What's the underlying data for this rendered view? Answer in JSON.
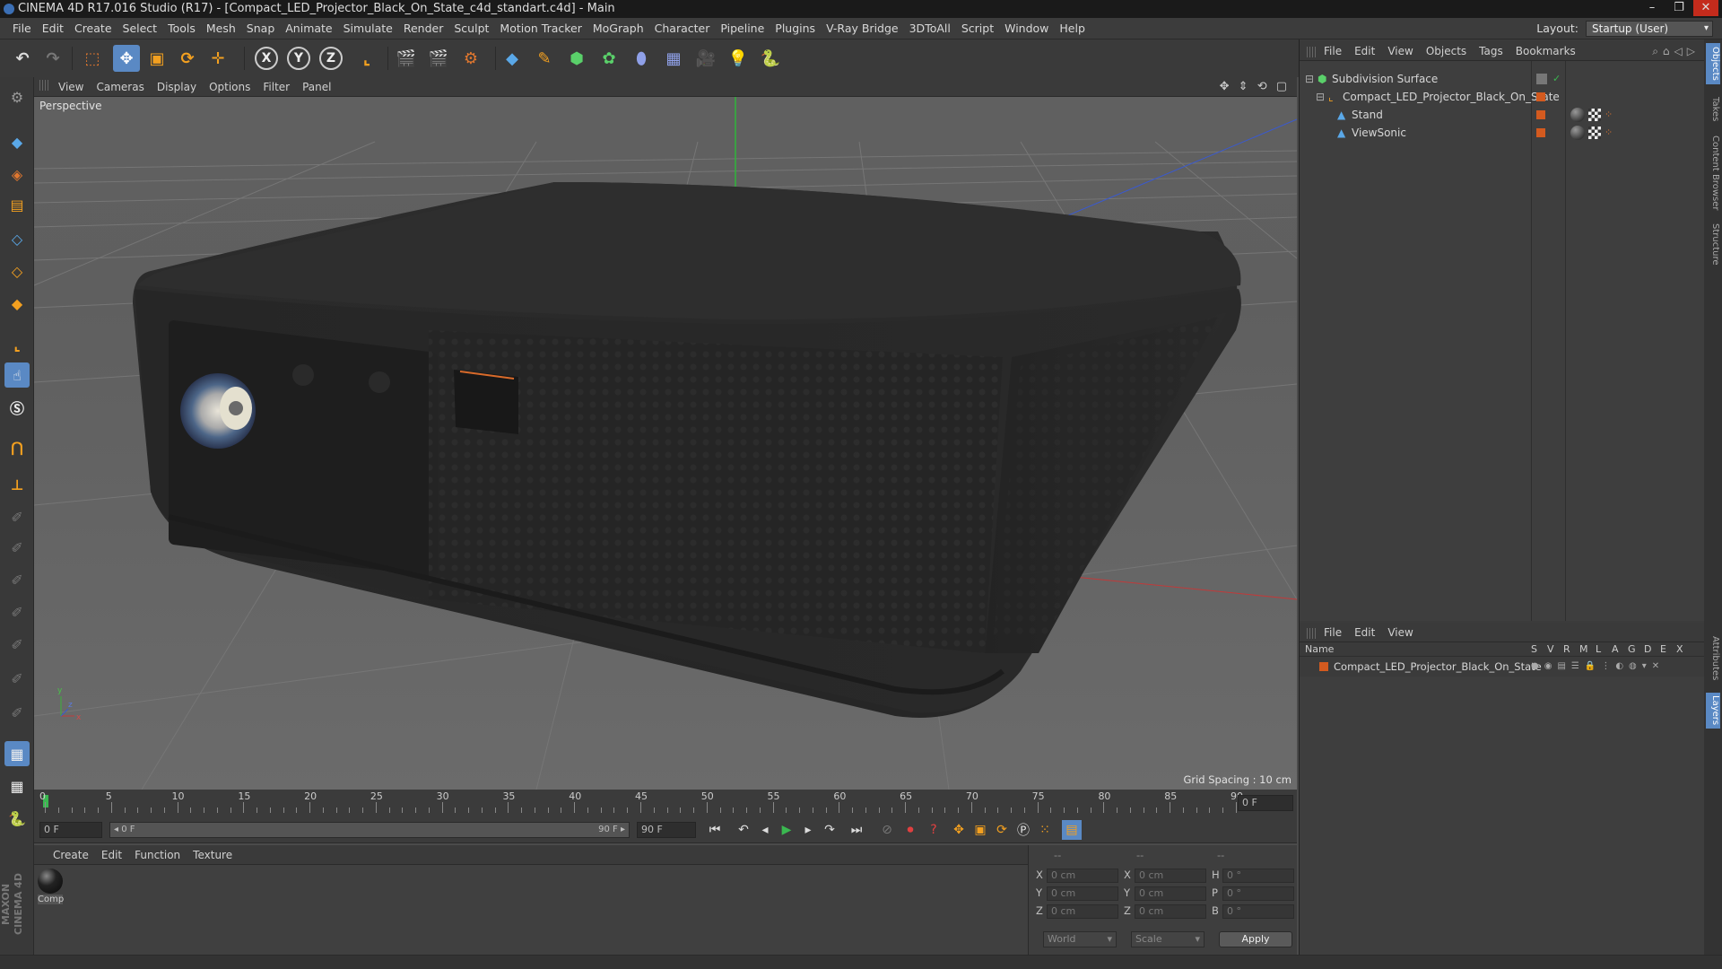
{
  "window": {
    "title": "CINEMA 4D R17.016 Studio (R17) - [Compact_LED_Projector_Black_On_State_c4d_standart.c4d] - Main",
    "controls": [
      "–",
      "❐",
      "✕"
    ]
  },
  "menubar": {
    "items": [
      "File",
      "Edit",
      "Create",
      "Select",
      "Tools",
      "Mesh",
      "Snap",
      "Animate",
      "Simulate",
      "Render",
      "Sculpt",
      "Motion Tracker",
      "MoGraph",
      "Character",
      "Pipeline",
      "Plugins",
      "V-Ray Bridge",
      "3DToAll",
      "Script",
      "Window",
      "Help"
    ],
    "layout_label": "Layout:",
    "layout_value": "Startup (User)"
  },
  "viewport": {
    "menu": [
      "View",
      "Cameras",
      "Display",
      "Options",
      "Filter",
      "Panel"
    ],
    "label": "Perspective",
    "grid_spacing": "Grid Spacing : 10 cm",
    "nav_icons": "✥ ⇕ ⟲ ▢"
  },
  "timeline": {
    "ticks": [
      "0",
      "5",
      "10",
      "15",
      "20",
      "25",
      "30",
      "35",
      "40",
      "45",
      "50",
      "55",
      "60",
      "65",
      "70",
      "75",
      "80",
      "85",
      "90"
    ],
    "current_frame_field": "0 F"
  },
  "time_controls": {
    "start_field": "0 F",
    "range_start": "0 F",
    "range_end": "90 F",
    "end_field": "90 F"
  },
  "material_manager": {
    "menu": [
      "Create",
      "Edit",
      "Function",
      "Texture"
    ],
    "materials": [
      {
        "name": "Comp"
      }
    ]
  },
  "coordinates": {
    "headers": [
      "--",
      "--",
      "--"
    ],
    "rows": [
      {
        "a": "X",
        "a_val": "0 cm",
        "b": "X",
        "b_val": "0 cm",
        "c": "H",
        "c_val": "0 °"
      },
      {
        "a": "Y",
        "a_val": "0 cm",
        "b": "Y",
        "b_val": "0 cm",
        "c": "P",
        "c_val": "0 °"
      },
      {
        "a": "Z",
        "a_val": "0 cm",
        "b": "Z",
        "b_val": "0 cm",
        "c": "B",
        "c_val": "0 °"
      }
    ],
    "mode": "World",
    "transform": "Scale",
    "apply_label": "Apply"
  },
  "object_manager": {
    "menu": [
      "File",
      "Edit",
      "View",
      "Objects",
      "Tags",
      "Bookmarks"
    ],
    "objects": [
      {
        "name": "Subdivision Surface"
      },
      {
        "name": "Compact_LED_Projector_Black_On_State"
      },
      {
        "name": "Stand"
      },
      {
        "name": "ViewSonic"
      }
    ]
  },
  "layer_manager": {
    "menu": [
      "File",
      "Edit",
      "View"
    ],
    "columns": [
      "Name",
      "S",
      "V",
      "R",
      "M",
      "L",
      "A",
      "G",
      "D",
      "E",
      "X"
    ],
    "layers": [
      {
        "name": "Compact_LED_Projector_Black_On_State"
      }
    ]
  },
  "side_tabs": [
    "Objects",
    "Takes",
    "Content Browser",
    "Structure",
    "Attributes",
    "Layers"
  ],
  "branding": {
    "logo_text": "MAXON CINEMA 4D"
  },
  "colors": {
    "accent": "#d35a1f",
    "active_tab": "#5a89c4"
  }
}
